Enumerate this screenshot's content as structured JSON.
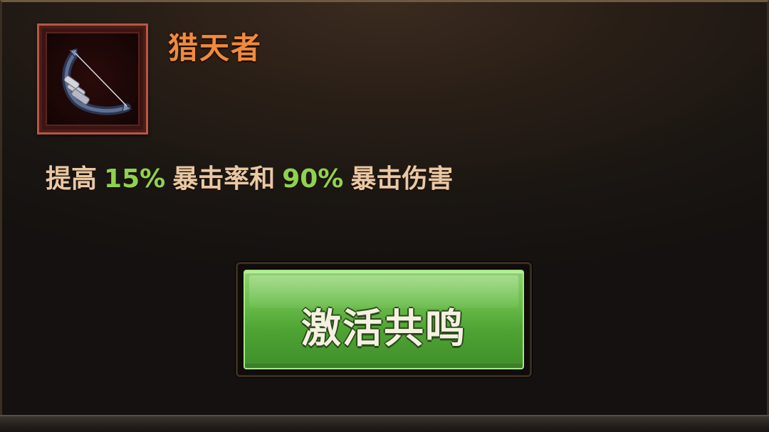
{
  "skill": {
    "title": "猎天者",
    "icon": "bow-icon",
    "description": {
      "prefix": "提高",
      "crit_rate_value": "15%",
      "crit_rate_text": "暴击率和",
      "crit_damage_value": "90%",
      "crit_damage_text": "暴击伤害"
    }
  },
  "actions": {
    "activate_label": "激活共鸣"
  },
  "colors": {
    "title": "#f08a3d",
    "description": "#e9c8a3",
    "highlight_value": "#8fd24d",
    "button": "#5cb33f",
    "frame": "#b65744"
  }
}
